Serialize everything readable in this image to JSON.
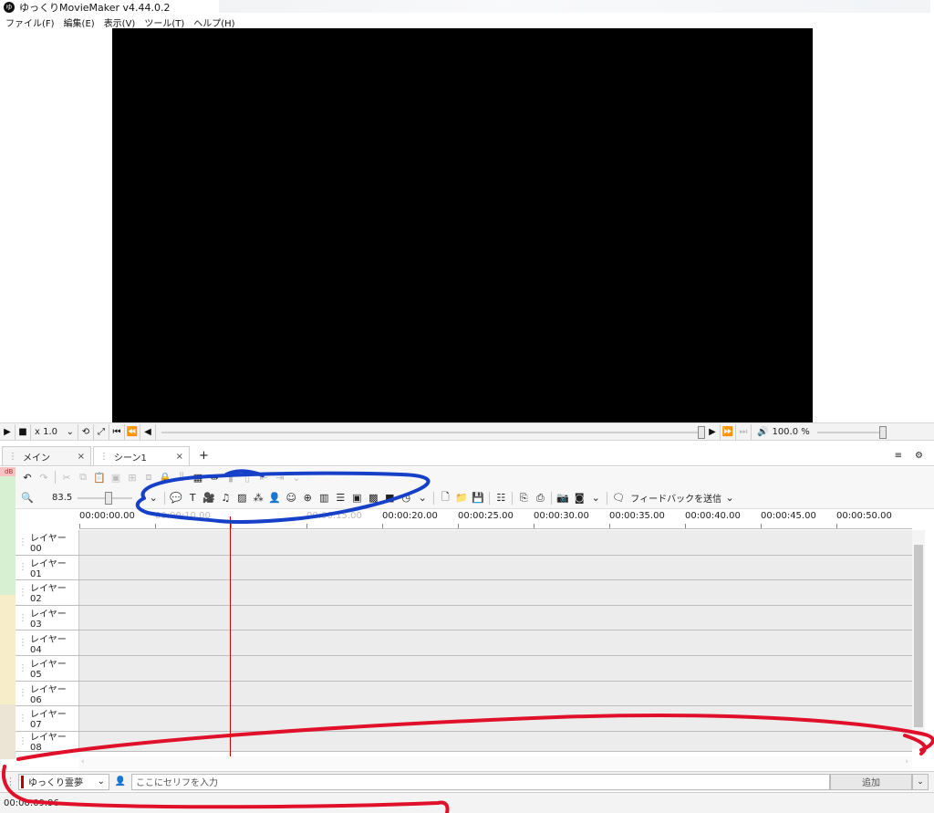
{
  "window": {
    "title": "ゆっくりMovieMaker v4.44.0.2",
    "logo_glyph": "ゆ"
  },
  "menu": [
    "ファイル(F)",
    "編集(E)",
    "表示(V)",
    "ツール(T)",
    "ヘルプ(H)"
  ],
  "playback": {
    "speed": "x 1.0",
    "speed_arrow": "⌄",
    "volume": "100.0 %"
  },
  "tabs": [
    {
      "label": "メイン",
      "close": "×",
      "grip": "⋮"
    },
    {
      "label": "シーン1",
      "close": "×",
      "grip": "⋮"
    }
  ],
  "tab_add": "+",
  "tab_menu_glyph": "≡",
  "settings_glyph": "⚙",
  "toolbar": {
    "db_label": "dB",
    "zoom_value": "83.5",
    "feedback_label": "フィードバックを送信"
  },
  "timeline": {
    "ticks": [
      "00:00:00.00",
      "00:00:10.00",
      "00:00:20.00",
      "00:00:25.00",
      "00:00:30.00",
      "00:00:35.00",
      "00:00:40.00",
      "00:00:45.00",
      "00:00:50.00"
    ],
    "playhead_time": "00:00:15.00",
    "layers": [
      "レイヤー 00",
      "レイヤー 01",
      "レイヤー 02",
      "レイヤー 03",
      "レイヤー 04",
      "レイヤー 05",
      "レイヤー 06",
      "レイヤー 07",
      "レイヤー 08"
    ]
  },
  "serif_bar": {
    "character": "ゆっくり霊夢",
    "placeholder": "ここにセリフを入力",
    "add_label": "追加"
  },
  "status": {
    "current_time": "00:00:09.96"
  },
  "colors": {
    "annotation_blue": "#1740c8",
    "annotation_red": "#e0102a",
    "playhead": "#c00000",
    "preview_bg": "#000000"
  }
}
